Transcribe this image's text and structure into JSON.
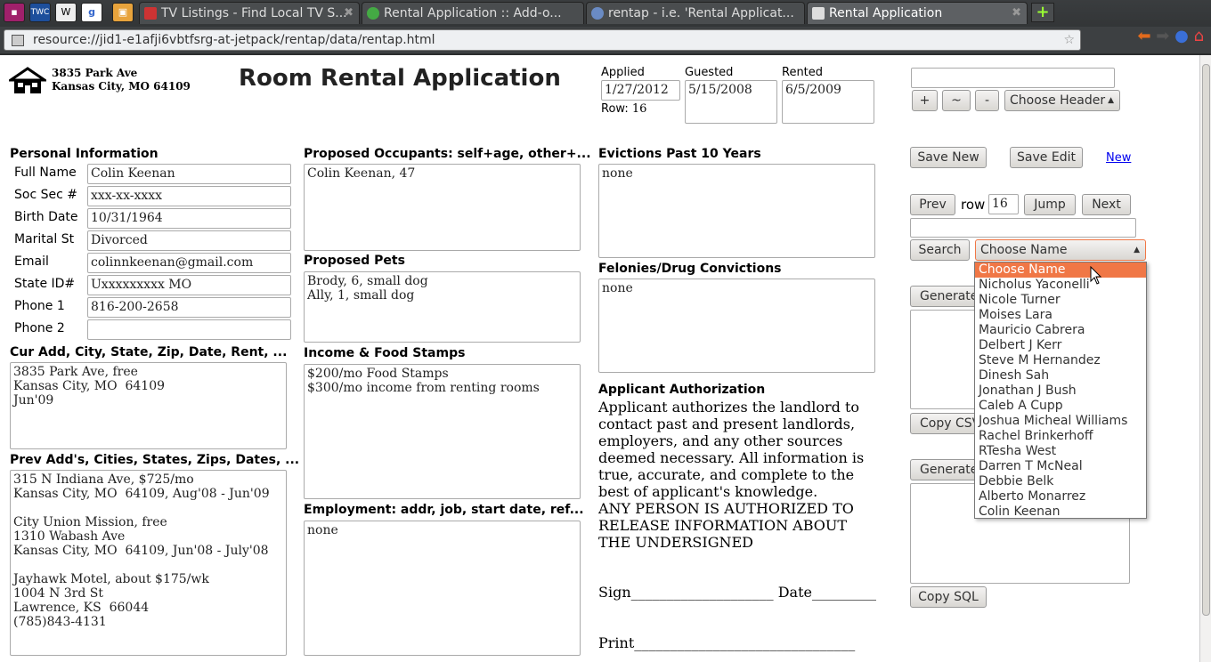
{
  "browser": {
    "pinned": [
      "▪",
      "TWC",
      "W",
      "g",
      "▣"
    ],
    "tabs": [
      {
        "label": "TV Listings - Find Local TV S..."
      },
      {
        "label": "Rental Application :: Add-o..."
      },
      {
        "label": "rentap - i.e. 'Rental Applicat..."
      },
      {
        "label": "Rental Application"
      }
    ],
    "url": "resource://jid1-e1afji6vbtfsrg-at-jetpack/rentap/data/rentap.html"
  },
  "header": {
    "address1": "3835 Park Ave",
    "address2": "Kansas City, MO  64109",
    "title": "Room Rental Application",
    "applied_label": "Applied",
    "applied": "1/27/2012",
    "row_label": "Row:",
    "row": "16",
    "guested_label": "Guested",
    "guested": "5/15/2008",
    "rented_label": "Rented",
    "rented": "6/5/2009"
  },
  "personal": {
    "heading": "Personal Information",
    "fields": [
      {
        "label": "Full Name",
        "value": "Colin Keenan"
      },
      {
        "label": "Soc Sec #",
        "value": "xxx-xx-xxxx"
      },
      {
        "label": "Birth Date",
        "value": "10/31/1964"
      },
      {
        "label": "Marital St",
        "value": "Divorced"
      },
      {
        "label": "Email",
        "value": "colinnkeenan@gmail.com"
      },
      {
        "label": "State ID#",
        "value": "Uxxxxxxxxx MO"
      },
      {
        "label": "Phone 1",
        "value": "816-200-2658"
      },
      {
        "label": "Phone 2",
        "value": ""
      }
    ]
  },
  "cur_add": {
    "heading": "Cur Add, City, State, Zip, Date, Rent, ...",
    "value": "3835 Park Ave, free\nKansas City, MO  64109\nJun'09"
  },
  "prev_add": {
    "heading": "Prev Add's, Cities, States, Zips, Dates, ...",
    "value": "315 N Indiana Ave, $725/mo\nKansas City, MO  64109, Aug'08 - Jun'09\n\nCity Union Mission, free\n1310 Wabash Ave\nKansas City, MO  64109, Jun'08 - July'08\n\nJayhawk Motel, about $175/wk\n1004 N 3rd St\nLawrence, KS  66044\n(785)843-4131"
  },
  "occupants": {
    "heading": "Proposed Occupants: self+age, other+...",
    "value": "Colin Keenan, 47"
  },
  "pets": {
    "heading": "Proposed Pets",
    "value": "Brody, 6, small dog\nAlly, 1, small dog"
  },
  "income": {
    "heading": "Income & Food Stamps",
    "value": "$200/mo Food Stamps\n$300/mo income from renting rooms"
  },
  "employment": {
    "heading": "Employment: addr, job, start date, ref...",
    "value": "none"
  },
  "evictions": {
    "heading": "Evictions Past 10 Years",
    "value": "none"
  },
  "felonies": {
    "heading": "Felonies/Drug Convictions",
    "value": "none"
  },
  "authorization": {
    "heading": "Applicant Authorization",
    "body": "Applicant authorizes the landlord to contact past and present landlords, employers, and any other sources deemed necessary. All information is true, accurate, and complete to the best of applicant's knowledge.",
    "caps1": "ANY PERSON IS AUTHORIZED TO",
    "caps2": "RELEASE INFORMATION ABOUT",
    "caps3": "THE UNDERSIGNED",
    "sign": "Sign____________________ Date_________",
    "print": "Print_______________________________"
  },
  "controls": {
    "header_field": "",
    "plus": "+",
    "tilde": "~",
    "minus": "-",
    "choose_header": "Choose Header",
    "save_new": "Save New",
    "save_edit": "Save Edit",
    "new_link": "New",
    "prev": "Prev",
    "row_label": "row",
    "row_value": "16",
    "jump": "Jump",
    "next": "Next",
    "search_field": "",
    "search": "Search",
    "choose_name": "Choose Name",
    "generate_csv": "Generate",
    "copy_csv": "Copy CSV",
    "generate_sql": "Generate",
    "copy_sql": "Copy SQL"
  },
  "name_options": [
    "Choose Name",
    "Nicholus Yaconelli",
    "Nicole Turner",
    "Moises Lara",
    "Mauricio Cabrera",
    "Delbert J Kerr",
    "Steve M Hernandez",
    "Dinesh Sah",
    "Jonathan J Bush",
    "Caleb A Cupp",
    "Joshua Micheal Williams",
    "Rachel Brinkerhoff",
    "RTesha West",
    "Darren T McNeal",
    "Debbie Belk",
    "Alberto Monarrez",
    "Colin Keenan"
  ],
  "colors": {
    "highlight": "#f07746",
    "chrome": "#2f3133"
  }
}
